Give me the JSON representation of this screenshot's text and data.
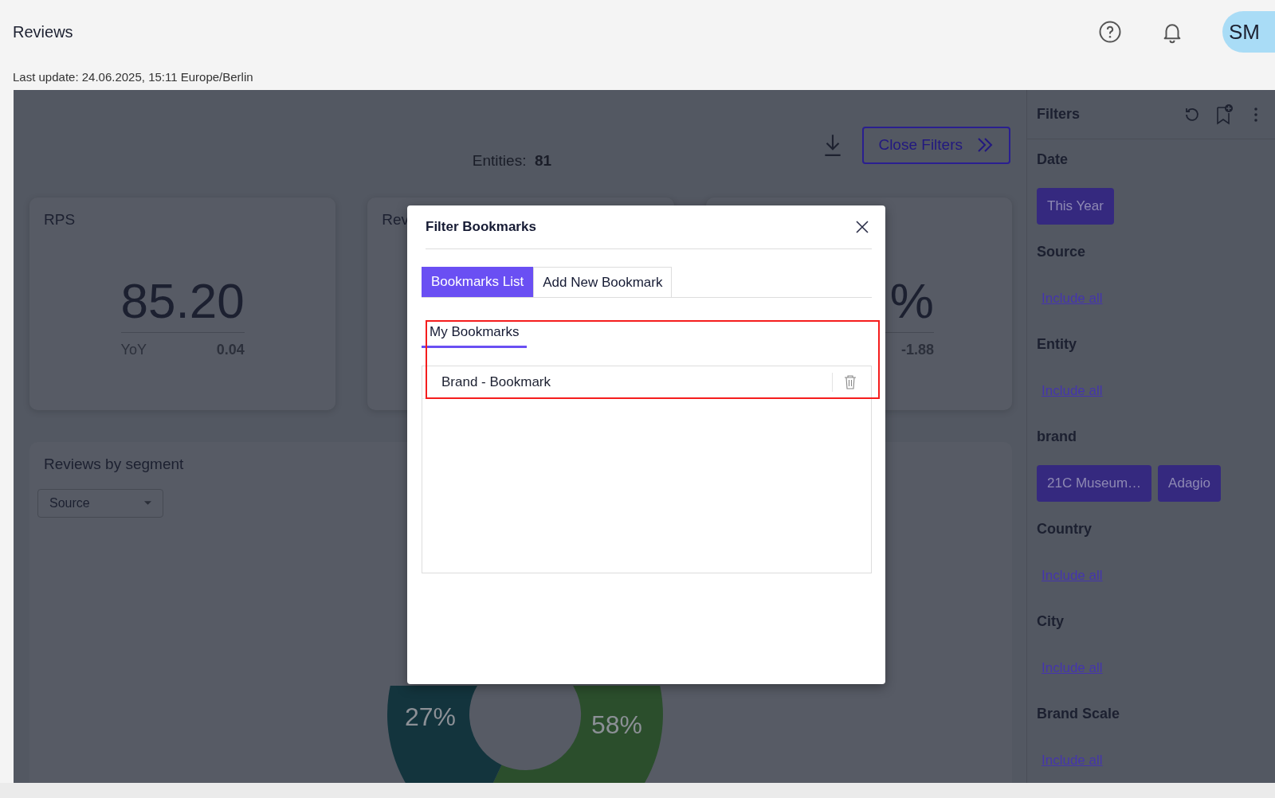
{
  "header": {
    "title": "Reviews",
    "last_update": "Last update: 24.06.2025, 15:11 Europe/Berlin",
    "avatar": "SM"
  },
  "toolbar": {
    "entities_label": "Entities:",
    "entities_value": "81",
    "close_filters_button": "Close Filters"
  },
  "kpi_cards": [
    {
      "title": "RPS",
      "value": "85.20",
      "delta_label": "YoY",
      "delta": "0.04"
    },
    {
      "title": "Rev"
    },
    {
      "value": "%",
      "delta": "-1.88"
    }
  ],
  "segment_card": {
    "title": "Reviews by segment",
    "dropdown": "Source",
    "donut_labels": [
      "27%",
      "58%"
    ]
  },
  "filters": {
    "title": "Filters",
    "sections": [
      {
        "label": "Date",
        "kind": "chips",
        "chips": [
          "This Year"
        ]
      },
      {
        "label": "Source",
        "kind": "link",
        "link": "Include all"
      },
      {
        "label": "Entity",
        "kind": "link",
        "link": "Include all"
      },
      {
        "label": "brand",
        "kind": "chips",
        "chips": [
          "21C Museum…",
          "Adagio"
        ]
      },
      {
        "label": "Country",
        "kind": "link",
        "link": "Include all"
      },
      {
        "label": "City",
        "kind": "link",
        "link": "Include all"
      },
      {
        "label": "Brand Scale",
        "kind": "link",
        "link": "Include all"
      }
    ]
  },
  "modal": {
    "title": "Filter Bookmarks",
    "tabs": [
      {
        "label": "Bookmarks List",
        "selected": true
      },
      {
        "label": "Add New Bookmark",
        "selected": false
      }
    ],
    "subtabs": [
      {
        "label": "My Bookmarks",
        "selected": true
      }
    ],
    "highlighted": true,
    "bookmarks": [
      "Brand - Bookmark"
    ]
  }
}
